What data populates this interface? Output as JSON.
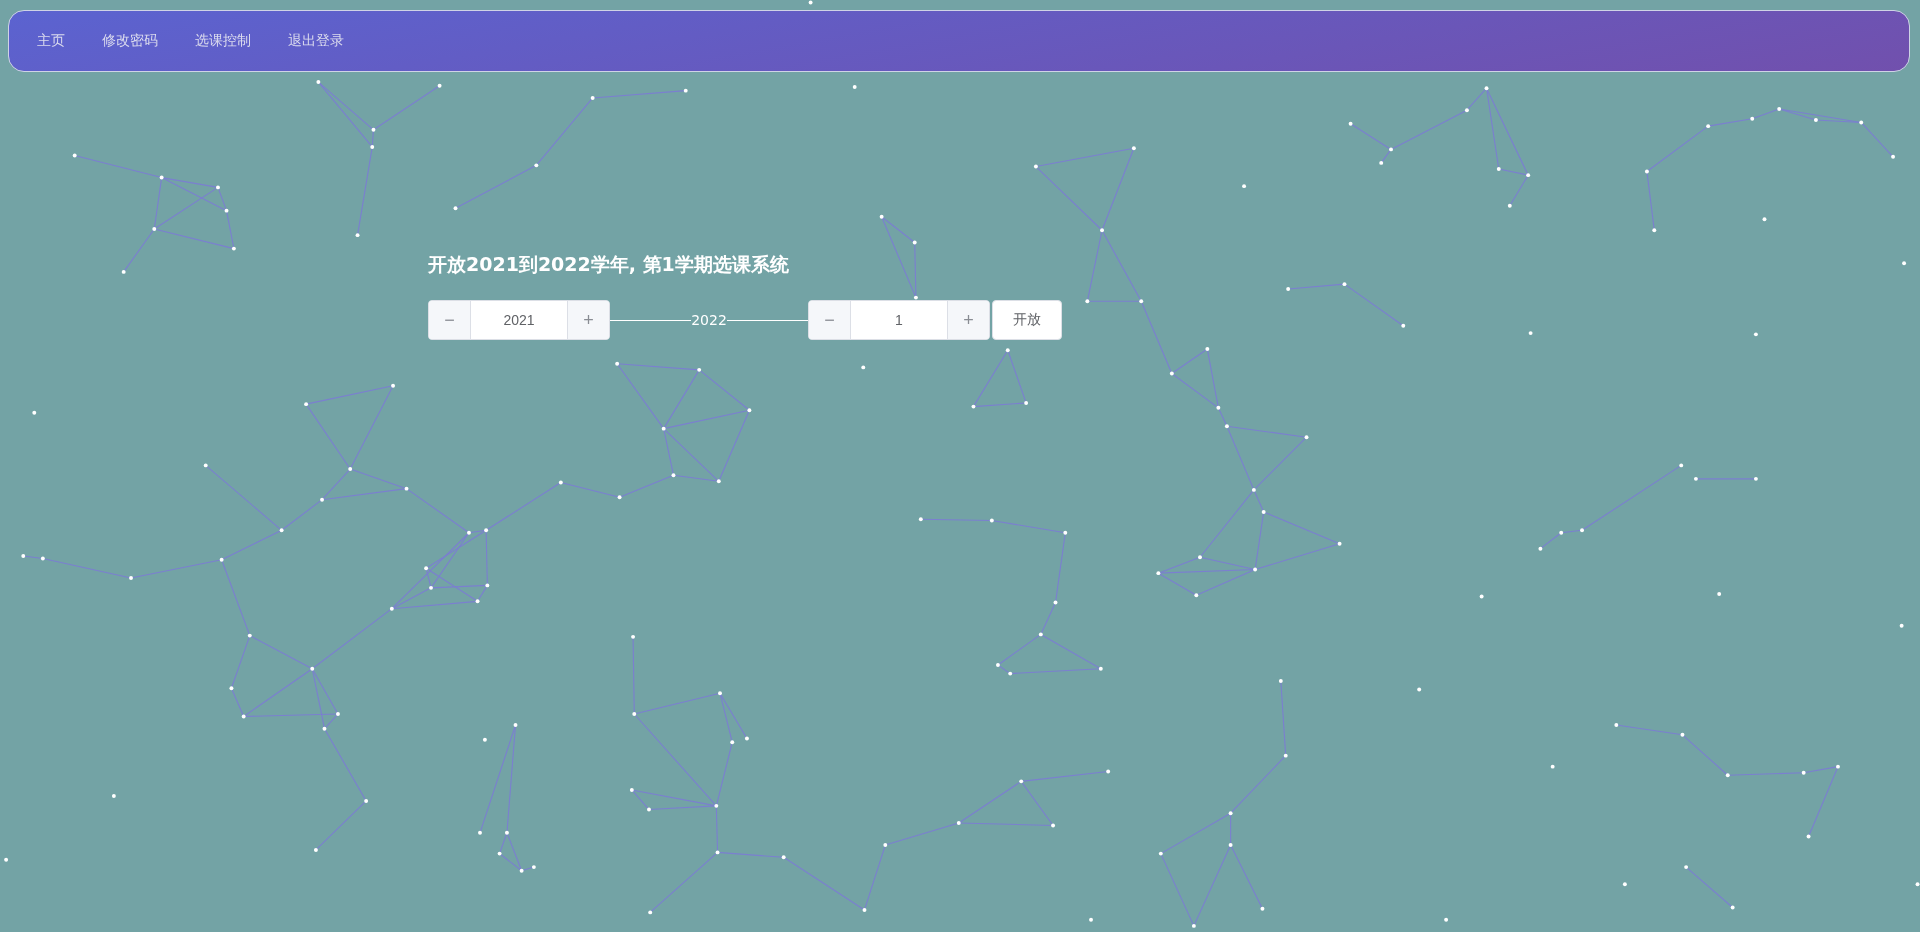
{
  "nav": {
    "items": [
      {
        "label": "主页"
      },
      {
        "label": "修改密码"
      },
      {
        "label": "选课控制"
      },
      {
        "label": "退出登录"
      }
    ]
  },
  "title": "开放2021到2022学年, 第1学期选课系统",
  "year_start": {
    "value": "2021",
    "minus": "−",
    "plus": "+"
  },
  "year_end": "2022",
  "term": {
    "value": "1",
    "minus": "−",
    "plus": "+"
  },
  "open_button": "开放"
}
